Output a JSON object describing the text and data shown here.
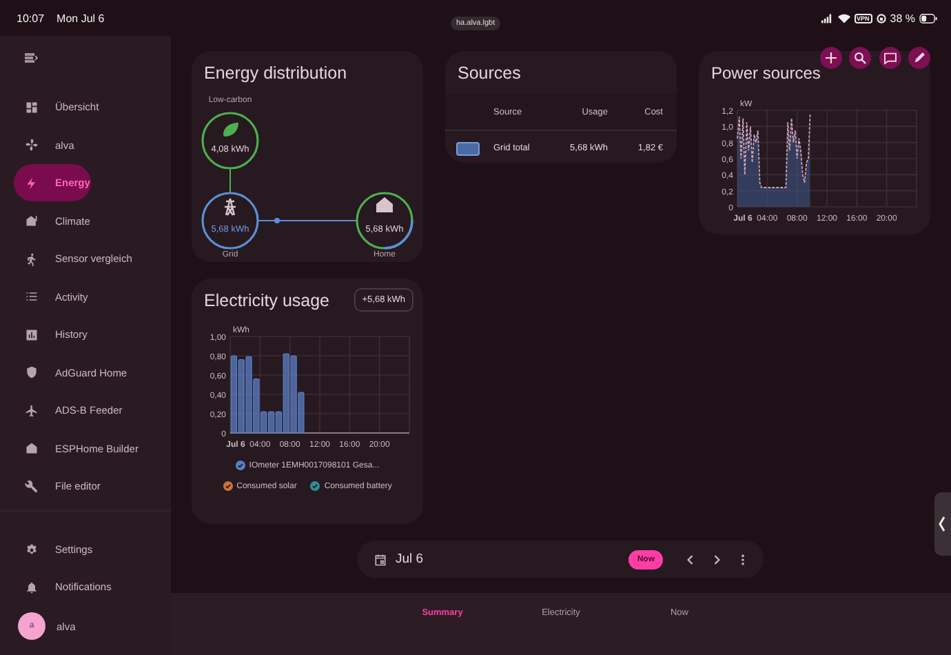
{
  "status_bar": {
    "time": "10:07",
    "date": "Mon Jul 6",
    "vpn": "VPN",
    "battery": "38 %"
  },
  "url": "ha.alva.lgbt",
  "sidebar": {
    "items": [
      {
        "label": "Übersicht",
        "selected": false
      },
      {
        "label": "alva",
        "selected": false
      },
      {
        "label": "Energy",
        "selected": true
      },
      {
        "label": "Climate",
        "selected": false
      },
      {
        "label": "Sensor vergleich",
        "selected": false
      },
      {
        "label": "Activity",
        "selected": false
      },
      {
        "label": "History",
        "selected": false
      },
      {
        "label": "AdGuard Home",
        "selected": false
      },
      {
        "label": "ADS-B Feeder",
        "selected": false
      },
      {
        "label": "ESPHome Builder",
        "selected": false
      },
      {
        "label": "File editor",
        "selected": false
      }
    ],
    "bottom_items": [
      {
        "label": "Settings"
      },
      {
        "label": "Notifications"
      }
    ],
    "user": {
      "initial": "a",
      "name": "alva"
    }
  },
  "energy_distribution": {
    "title": "Energy distribution",
    "nodes": [
      {
        "kind": "low_carbon",
        "label": "Low-carbon",
        "value": "4,08 kWh"
      },
      {
        "kind": "grid",
        "label": "Grid",
        "value": "5,68 kWh"
      },
      {
        "kind": "home",
        "label": "Home",
        "value": "5,68 kWh"
      }
    ]
  },
  "sources": {
    "title": "Sources",
    "columns": [
      "Source",
      "Usage",
      "Cost"
    ],
    "rows": [
      {
        "source": "Grid total",
        "usage": "5,68 kWh",
        "cost": "1,82 €"
      }
    ]
  },
  "electricity_usage": {
    "title": "Electricity usage",
    "total": "+5,68 kWh",
    "chart_data": {
      "type": "bar",
      "ylabel": "kWh",
      "grid": true,
      "x": [
        0.5,
        1.5,
        2.5,
        3.5,
        4.5,
        5.5,
        6.5,
        7.5,
        8.5,
        9.5
      ],
      "series": [
        {
          "name": "IOmeter 1EMH0017098101 Gesa...",
          "color": "#5b7fc4",
          "values": [
            0.8,
            0.76,
            0.79,
            0.56,
            0.22,
            0.22,
            0.22,
            0.82,
            0.8,
            0.42
          ]
        }
      ],
      "xlim": [
        0,
        24
      ],
      "ylim": [
        0,
        1
      ],
      "xticks": [
        {
          "value": 0,
          "label": "Jul 6"
        },
        {
          "value": 4,
          "label": "04:00"
        },
        {
          "value": 8,
          "label": "08:00"
        },
        {
          "value": 12,
          "label": "12:00"
        },
        {
          "value": 16,
          "label": "16:00"
        },
        {
          "value": 20,
          "label": "20:00"
        }
      ],
      "yticks": [
        {
          "value": 0,
          "label": "0"
        },
        {
          "value": 0.2,
          "label": "0,20"
        },
        {
          "value": 0.4,
          "label": "0,40"
        },
        {
          "value": 0.6,
          "label": "0,60"
        },
        {
          "value": 0.8,
          "label": "0,80"
        },
        {
          "value": 1,
          "label": "1,00"
        }
      ]
    },
    "legend": [
      {
        "kind": "series",
        "checked": true
      },
      {
        "kind": "entry",
        "label": "Consumed solar",
        "checked": true,
        "color": "#c8733a"
      },
      {
        "kind": "entry",
        "label": "Consumed battery",
        "checked": true,
        "color": "#2f8c99"
      }
    ]
  },
  "power_sources": {
    "title": "Power sources",
    "chart_data": {
      "type": "area",
      "ylabel": "kW",
      "grid": true,
      "x": [
        0,
        0.25,
        0.5,
        0.75,
        1,
        1.25,
        1.5,
        1.75,
        2,
        2.25,
        2.5,
        2.75,
        3,
        3.25,
        3.5,
        3.75,
        4,
        4.25,
        4.5,
        4.75,
        5,
        5.25,
        5.5,
        5.75,
        6,
        6.25,
        6.5,
        6.75,
        7,
        7.25,
        7.5,
        7.75,
        8,
        8.25,
        8.5,
        8.75,
        9,
        9.25,
        9.5,
        9.75
      ],
      "series": [
        {
          "color": "#c9a2b8",
          "values": [
            0.85,
            1.12,
            0.6,
            1.1,
            0.4,
            1.05,
            0.7,
            1.0,
            0.55,
            0.9,
            0.8,
            0.95,
            0.3,
            0.24,
            0.24,
            0.24,
            0.24,
            0.24,
            0.24,
            0.24,
            0.24,
            0.24,
            0.24,
            0.24,
            0.24,
            0.24,
            0.24,
            1.05,
            0.7,
            1.1,
            0.8,
            0.95,
            0.6,
            0.85,
            0.7,
            0.4,
            0.3,
            0.55,
            0.6,
            1.15
          ]
        }
      ],
      "xlim": [
        0,
        24
      ],
      "ylim": [
        0,
        1.2
      ],
      "xticks": [
        {
          "value": 0,
          "label": "Jul 6"
        },
        {
          "value": 4,
          "label": "04:00"
        },
        {
          "value": 8,
          "label": "08:00"
        },
        {
          "value": 12,
          "label": "12:00"
        },
        {
          "value": 16,
          "label": "16:00"
        },
        {
          "value": 20,
          "label": "20:00"
        }
      ],
      "yticks": [
        {
          "value": 0,
          "label": "0"
        },
        {
          "value": 0.2,
          "label": "0,2"
        },
        {
          "value": 0.4,
          "label": "0,4"
        },
        {
          "value": 0.6,
          "label": "0,6"
        },
        {
          "value": 0.8,
          "label": "0,8"
        },
        {
          "value": 1,
          "label": "1,0"
        },
        {
          "value": 1.2,
          "label": "1,2"
        }
      ]
    }
  },
  "date_bar": {
    "date": "Jul 6",
    "now": "Now"
  },
  "tabs": [
    {
      "label": "Summary",
      "selected": true
    },
    {
      "label": "Electricity",
      "selected": false
    },
    {
      "label": "Now",
      "selected": false
    }
  ]
}
